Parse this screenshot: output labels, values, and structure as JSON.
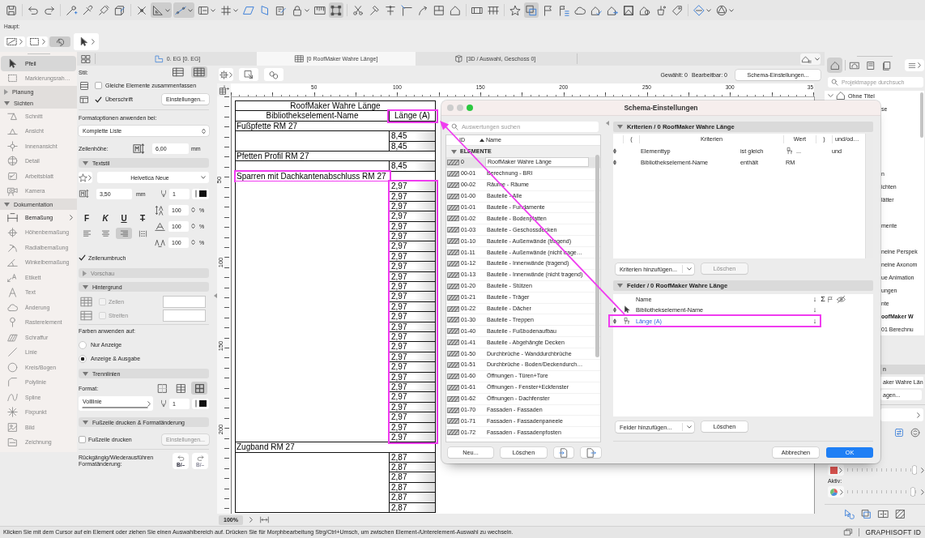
{
  "toolbar": {
    "groups": [
      [
        {
          "pressed": false,
          "menu": false
        }
      ],
      [
        {
          "pressed": false,
          "menu": false
        },
        {
          "pressed": false,
          "menu": false
        }
      ],
      [
        {
          "pressed": false,
          "menu": false
        },
        {
          "pressed": false,
          "menu": false
        },
        {
          "pressed": false,
          "menu": false
        },
        {
          "pressed": false,
          "menu": false
        }
      ],
      [
        {
          "pressed": false,
          "menu": false
        },
        {
          "pressed": true,
          "menu": true
        },
        {
          "pressed": true,
          "menu": true
        },
        {
          "pressed": false,
          "menu": true
        },
        {
          "pressed": false,
          "menu": true
        },
        {
          "pressed": false,
          "menu": false
        },
        {
          "pressed": false,
          "menu": false
        },
        {
          "pressed": false,
          "menu": false
        },
        {
          "pressed": false,
          "menu": true
        },
        {
          "pressed": false,
          "menu": false
        },
        {
          "pressed": true,
          "menu": false
        }
      ],
      [
        {
          "pressed": false,
          "menu": false
        },
        {
          "pressed": false,
          "menu": false
        },
        {
          "pressed": false,
          "menu": false
        },
        {
          "pressed": false,
          "menu": false
        },
        {
          "pressed": false,
          "menu": false
        },
        {
          "pressed": false,
          "menu": false
        },
        {
          "pressed": false,
          "menu": false
        }
      ],
      [
        {
          "pressed": false,
          "menu": false
        },
        {
          "pressed": false,
          "menu": false
        }
      ],
      [
        {
          "pressed": false,
          "menu": false
        },
        {
          "pressed": true,
          "menu": false
        },
        {
          "pressed": false,
          "menu": false
        },
        {
          "pressed": false,
          "menu": false
        },
        {
          "pressed": false,
          "menu": false
        },
        {
          "pressed": false,
          "menu": false
        },
        {
          "pressed": false,
          "menu": false
        },
        {
          "pressed": false,
          "menu": false
        },
        {
          "pressed": false,
          "menu": false
        },
        {
          "pressed": false,
          "menu": false
        },
        {
          "pressed": false,
          "menu": false
        }
      ],
      [
        {
          "pressed": false,
          "menu": true
        },
        {
          "pressed": false,
          "menu": true
        }
      ]
    ]
  },
  "secondary_toolbar": {
    "label": "Haupt:",
    "buttons": [
      {
        "kind": "menu",
        "pressed": false
      },
      {
        "kind": "menu",
        "pressed": false
      },
      {
        "kind": "toggle",
        "pressed": true
      },
      {
        "kind": "tool",
        "pressed": false
      }
    ]
  },
  "toolbox": {
    "tools": [
      {
        "label": "Pfeil",
        "selected": true,
        "disabled": false,
        "submenu": false
      },
      {
        "label": "Markierungsrah…",
        "selected": false,
        "disabled": true,
        "submenu": false
      }
    ],
    "groups": [
      {
        "label": "Planung",
        "expanded": false
      },
      {
        "label": "Sichten",
        "expanded": true,
        "tools": [
          {
            "label": "Schnitt",
            "selected": false,
            "disabled": true,
            "submenu": false
          },
          {
            "label": "Ansicht",
            "selected": false,
            "disabled": true,
            "submenu": false
          },
          {
            "label": "Innenansicht",
            "selected": false,
            "disabled": true,
            "submenu": false
          },
          {
            "label": "Detail",
            "selected": false,
            "disabled": true,
            "submenu": false
          },
          {
            "label": "Arbeitsblatt",
            "selected": false,
            "disabled": true,
            "submenu": false
          },
          {
            "label": "Kamera",
            "selected": false,
            "disabled": true,
            "submenu": false
          }
        ]
      },
      {
        "label": "Dokumentation",
        "expanded": true,
        "tools": [
          {
            "label": "Bemaßung",
            "selected": false,
            "disabled": false,
            "submenu": true
          },
          {
            "label": "Höhenbemaßung",
            "selected": false,
            "disabled": true,
            "submenu": false
          },
          {
            "label": "Radialbemaßung",
            "selected": false,
            "disabled": true,
            "submenu": false
          },
          {
            "label": "Winkelbemaßung",
            "selected": false,
            "disabled": true,
            "submenu": false
          },
          {
            "label": "Etikett",
            "selected": false,
            "disabled": true,
            "submenu": false
          },
          {
            "label": "Text",
            "selected": false,
            "disabled": true,
            "submenu": false
          },
          {
            "label": "Änderung",
            "selected": false,
            "disabled": true,
            "submenu": false
          },
          {
            "label": "Rasterelement",
            "selected": false,
            "disabled": true,
            "submenu": false
          },
          {
            "label": "Schraffur",
            "selected": false,
            "disabled": true,
            "submenu": false
          },
          {
            "label": "Linie",
            "selected": false,
            "disabled": true,
            "submenu": false
          },
          {
            "label": "Kreis/Bogen",
            "selected": false,
            "disabled": true,
            "submenu": false
          },
          {
            "label": "Polylinie",
            "selected": false,
            "disabled": true,
            "submenu": false
          },
          {
            "label": "Spline",
            "selected": false,
            "disabled": true,
            "submenu": false
          },
          {
            "label": "Fixpunkt",
            "selected": false,
            "disabled": true,
            "submenu": false
          },
          {
            "label": "Bild",
            "selected": false,
            "disabled": true,
            "submenu": false
          },
          {
            "label": "Zeichnung",
            "selected": false,
            "disabled": true,
            "submenu": false
          }
        ]
      }
    ]
  },
  "tabs": [
    {
      "label": "0. EG [0. EG]",
      "selected": false,
      "kind": "plan"
    },
    {
      "label": "[0 RoofMaker Wahre Länge]",
      "selected": true,
      "kind": "schedule"
    },
    {
      "label": "[3D / Auswahl, Geschoss 0]",
      "selected": false,
      "kind": "model"
    }
  ],
  "settings": {
    "style": {
      "label": "Stil:",
      "options": [
        {
          "selected": false
        },
        {
          "selected": true
        }
      ]
    },
    "merge": {
      "label": "Gleiche Elemente zusammenfassen",
      "checked": false
    },
    "heading": {
      "label": "Überschrift",
      "checked": true,
      "button": "Einstellungen..."
    },
    "apply_label": "Formatoptionen anwenden bei:",
    "apply_value": "Komplette Liste",
    "row_height": {
      "label": "Zeilenhöhe:",
      "value": "6,00",
      "unit": "mm"
    },
    "text_style": {
      "title": "Textstil",
      "expanded": true,
      "font": "Helvetica Neue",
      "size": "3,50",
      "unit": "mm",
      "pen": "1",
      "formats": [
        {
          "label": "F",
          "kind": "bold",
          "pressed": false
        },
        {
          "label": "K",
          "kind": "italic",
          "pressed": false
        },
        {
          "label": "U",
          "kind": "underline",
          "pressed": false
        },
        {
          "label": "T",
          "kind": "strike",
          "pressed": false
        }
      ],
      "alignments": [
        {
          "selected": false
        },
        {
          "selected": false
        },
        {
          "selected": true
        },
        {
          "selected": false
        }
      ],
      "scales": [
        {
          "value": "100",
          "unit": "%"
        },
        {
          "value": "100",
          "unit": "%"
        },
        {
          "value": "100",
          "unit": "%"
        }
      ]
    },
    "wrap": {
      "label": "Zeilenumbruch",
      "checked": true
    },
    "preview": {
      "title": "Vorschau",
      "expanded": false,
      "disabled": true
    },
    "background": {
      "title": "Hintergrund",
      "expanded": true,
      "options": [
        {
          "label": "Zellen",
          "checked": false,
          "disabled": true
        },
        {
          "label": "Streifen",
          "checked": false,
          "disabled": true
        }
      ]
    },
    "colors": {
      "label": "Farben anwenden auf:",
      "options": [
        {
          "label": "Nur Anzeige",
          "selected": false
        },
        {
          "label": "Anzeige & Ausgabe",
          "selected": true
        }
      ]
    },
    "lines": {
      "title": "Trennlinien",
      "expanded": true,
      "label": "Format:",
      "formats": [
        {
          "selected": false
        },
        {
          "selected": false
        },
        {
          "selected": true
        }
      ],
      "line_type": "Volllinie",
      "pen": "1"
    },
    "footer": {
      "title": "Fußzeile drucken & Formatänderung",
      "expanded": true,
      "print": {
        "label": "Fußzeile drucken",
        "checked": false
      },
      "button": {
        "label": "Einstellungen...",
        "disabled": true
      },
      "undo_label": "Rückgängig/Wiederausführen Formatänderung:",
      "undo_buttons": [
        {
          "label": "B/–",
          "disabled": false
        },
        {
          "label": "B/–",
          "disabled": true
        }
      ]
    }
  },
  "view": {
    "selected_count": "Gewählt: 0",
    "editable_count": "Bearbeitbar: 0",
    "settings_button": "Schema-Einstellungen...",
    "ruler": [
      "50",
      "100",
      "150",
      "200",
      "250",
      "300",
      "35"
    ],
    "vertical_ruler": [
      "50",
      "100",
      "150",
      "200"
    ],
    "zoom": "100%"
  },
  "schedule": {
    "title": "RoofMaker Wahre Länge",
    "columns": [
      {
        "label": "Bibliothekselement-Name",
        "highlighted": false
      },
      {
        "label": "Länge (A)",
        "highlighted": true
      }
    ],
    "groups": [
      {
        "name": "Fußpfette RM 27",
        "highlighted": false,
        "values_highlighted": false,
        "values": [
          "8,45",
          "8,45"
        ]
      },
      {
        "name": "Pfetten Profil RM 27",
        "highlighted": false,
        "values_highlighted": false,
        "values": [
          "8,45"
        ]
      },
      {
        "name": "Sparren mit Dachkantenabschluss RM 27",
        "highlighted": true,
        "values_highlighted": true,
        "values": [
          "2,97",
          "2,97",
          "2,97",
          "2,97",
          "2,97",
          "2,97",
          "2,97",
          "2,97",
          "2,97",
          "2,97",
          "2,97",
          "2,97",
          "2,97",
          "2,97",
          "2,97",
          "2,97",
          "2,97",
          "2,97",
          "2,97",
          "2,97",
          "2,97",
          "2,97",
          "2,97",
          "2,97",
          "2,97",
          "2,97"
        ]
      },
      {
        "name": "Zugband RM 27",
        "highlighted": false,
        "values_highlighted": false,
        "values": [
          "2,87",
          "2,87",
          "2,87",
          "2,87",
          "2,87",
          "2,87"
        ]
      }
    ]
  },
  "dialog": {
    "title": "Schema-Einstellungen",
    "search_placeholder": "Auswertungen suchen",
    "list_columns": [
      "ID",
      "Name"
    ],
    "group": {
      "label": "ELEMENTE",
      "expanded": true
    },
    "items": [
      {
        "id": "0",
        "name": "RoofMaker Wahre Länge",
        "selected": true
      },
      {
        "id": "00-01",
        "name": "Berechnung - BRI",
        "selected": false
      },
      {
        "id": "00-02",
        "name": "Räume - Räume",
        "selected": false
      },
      {
        "id": "01-00",
        "name": "Bauteile - Alle",
        "selected": false
      },
      {
        "id": "01-01",
        "name": "Bauteile - Fundamente",
        "selected": false
      },
      {
        "id": "01-02",
        "name": "Bauteile - Bodenplatten",
        "selected": false
      },
      {
        "id": "01-03",
        "name": "Bauteile - Geschossdecken",
        "selected": false
      },
      {
        "id": "01-10",
        "name": "Bauteile - Außenwände (tragend)",
        "selected": false
      },
      {
        "id": "01-11",
        "name": "Bauteile - Außenwände (nicht trage…",
        "selected": false
      },
      {
        "id": "01-12",
        "name": "Bauteile - Innenwände (tragend)",
        "selected": false
      },
      {
        "id": "01-13",
        "name": "Bauteile - Innenwände (nicht tragend)",
        "selected": false
      },
      {
        "id": "01-20",
        "name": "Bauteile - Stützen",
        "selected": false
      },
      {
        "id": "01-21",
        "name": "Bauteile - Träger",
        "selected": false
      },
      {
        "id": "01-22",
        "name": "Bauteile - Dächer",
        "selected": false
      },
      {
        "id": "01-30",
        "name": "Bauteile - Treppen",
        "selected": false
      },
      {
        "id": "01-40",
        "name": "Bauteile - Fußbodenaufbau",
        "selected": false
      },
      {
        "id": "01-41",
        "name": "Bauteile - Abgehängte Decken",
        "selected": false
      },
      {
        "id": "01-50",
        "name": "Durchbrüche - Wanddurchbrüche",
        "selected": false
      },
      {
        "id": "01-51",
        "name": "Durchbrüche - Boden/Deckendurch…",
        "selected": false
      },
      {
        "id": "01-60",
        "name": "Öffnungen - Türen+Tore",
        "selected": false
      },
      {
        "id": "01-61",
        "name": "Öffnungen - Fenster+Eckfenster",
        "selected": false
      },
      {
        "id": "01-62",
        "name": "Öffnungen - Dachfenster",
        "selected": false
      },
      {
        "id": "01-70",
        "name": "Fassaden - Fassaden",
        "selected": false
      },
      {
        "id": "01-71",
        "name": "Fassaden - Fassadenpaneele",
        "selected": false
      },
      {
        "id": "01-72",
        "name": "Fassaden - Fassadenpfosten",
        "selected": false
      }
    ],
    "list_buttons": [
      {
        "kind": "text",
        "label": "Neu..."
      },
      {
        "kind": "text",
        "label": "Löschen"
      },
      {
        "kind": "import"
      },
      {
        "kind": "export"
      }
    ],
    "criteria": {
      "title": "Kriterien / 0 RoofMaker Wahre Länge",
      "expanded": true,
      "columns": [
        "(",
        "Kriterien",
        "Wert",
        ")",
        "und/od…"
      ],
      "rows": [
        {
          "criterion": "Elementtyp",
          "operator": "ist gleich",
          "value": "...",
          "value_icon": true,
          "conjunction": "und"
        },
        {
          "criterion": "Bibliothekselement-Name",
          "operator": "enthält",
          "value": "RM",
          "value_icon": false
        }
      ],
      "add_button": "Kriterien hinzufügen...",
      "delete_button": {
        "label": "Löschen",
        "disabled": true
      }
    },
    "fields": {
      "title": "Felder / 0 RoofMaker Wahre Länge",
      "expanded": true,
      "columns": [
        "Name",
        "↓",
        "Σ"
      ],
      "rows": [
        {
          "name": "Bibliothekselement-Name",
          "kind": "selection",
          "sort": "↓",
          "selected": false,
          "highlighted": false
        },
        {
          "name": "Länge (A)",
          "kind": "object",
          "sort": "↓",
          "selected": true,
          "highlighted": true
        }
      ],
      "add_button": "Felder hinzufügen...",
      "delete_button": {
        "label": "Löschen",
        "disabled": false
      }
    },
    "buttons": [
      {
        "label": "Abbrechen",
        "primary": false
      },
      {
        "label": "OK",
        "primary": true
      }
    ]
  },
  "project_panel": {
    "search_placeholder": "Projektmappe durchsuch",
    "tree": {
      "label": "Ohne Titel",
      "expanded": true,
      "children": [
        {
          "label": "se",
          "selected": false
        },
        {
          "label": "n",
          "selected": false
        },
        {
          "label": "ichten",
          "selected": false
        },
        {
          "label": "lätter",
          "selected": false
        },
        {
          "label": "mente",
          "selected": false
        },
        {
          "label": "neine Perspek",
          "selected": false
        },
        {
          "label": "neine Axonom",
          "selected": false
        },
        {
          "label": "ue Animation",
          "selected": false
        },
        {
          "label": "ungen",
          "selected": false
        },
        {
          "label": "nte",
          "selected": false
        },
        {
          "label": "oofMaker W",
          "selected": true
        },
        {
          "label": "01 Berechnu",
          "selected": false
        }
      ]
    },
    "name_header": "n",
    "name_field": "aker Wahre Län",
    "name_button": "agen...",
    "sliders": [
      {
        "level": 0.96
      },
      {
        "level": 0.94
      }
    ],
    "active_label": "Aktiv:"
  },
  "status_bar": {
    "message": "Klicken Sie mit dem Cursor auf ein Element oder ziehen Sie einen Auswahlbereich auf. Drücken Sie für Morphbearbeitung Strg/Ctrl+Umsch, um zwischen Element-/Unterelement-Auswahl zu wechseln.",
    "account": "GRAPHISOFT ID"
  }
}
